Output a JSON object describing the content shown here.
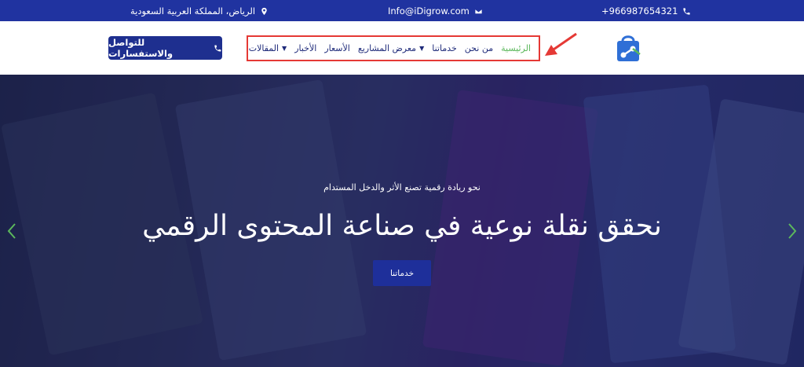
{
  "topbar": {
    "phone": "+966987654321",
    "email": "Info@iDigrow.com",
    "location": "الرياض، المملكة العربية السعودية"
  },
  "header": {
    "cta_label": "للتواصل والاستفسارات",
    "nav": [
      {
        "label": "الرئيسية",
        "active": true,
        "dropdown": false
      },
      {
        "label": "من نحن",
        "active": false,
        "dropdown": false
      },
      {
        "label": "خدماتنا",
        "active": false,
        "dropdown": false
      },
      {
        "label": "معرض المشاريع",
        "active": false,
        "dropdown": true
      },
      {
        "label": "الأسعار",
        "active": false,
        "dropdown": false
      },
      {
        "label": "الأخبار",
        "active": false,
        "dropdown": false
      },
      {
        "label": "المقالات",
        "active": false,
        "dropdown": true
      }
    ]
  },
  "hero": {
    "subtitle": "نحو ريادة رقمية تصنع الأثر والدخل المستدام",
    "title": "نحقق نقلة نوعية في صناعة المحتوى الرقمي",
    "button_label": "خدماتنا"
  },
  "colors": {
    "topbar_bg": "#2033a0",
    "primary": "#1e2f8f",
    "active_nav": "#5cb85c",
    "highlight_border": "#e53935",
    "slider_arrow": "#5cb85c"
  }
}
